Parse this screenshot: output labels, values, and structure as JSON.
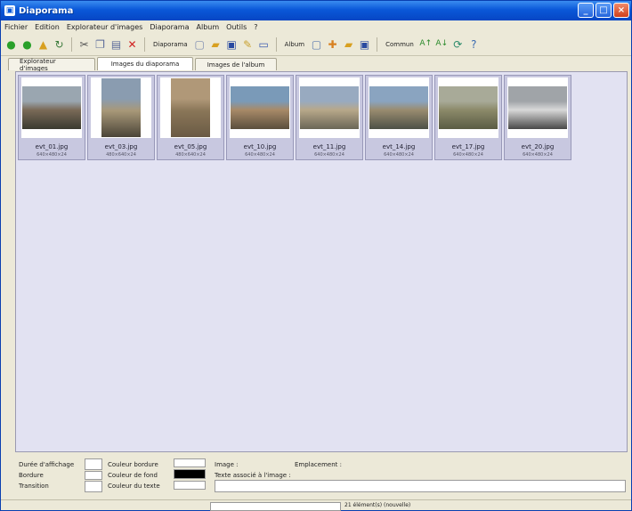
{
  "window": {
    "title": "Diaporama"
  },
  "menu": [
    "Fichier",
    "Edition",
    "Explorateur d'images",
    "Diaporama",
    "Album",
    "Outils",
    "?"
  ],
  "toolbar": {
    "diaporama_label": "Diaporama",
    "album_label": "Album",
    "commun_label": "Commun",
    "icons": [
      "back-icon",
      "forward-icon",
      "up-icon",
      "refresh-icon",
      "cut-icon",
      "copy-icon",
      "paste-icon",
      "delete-icon",
      "new-icon",
      "open-icon",
      "save-icon",
      "properties-icon",
      "view-icon",
      "album-new-icon",
      "album-add-icon",
      "album-open-icon",
      "album-save-icon",
      "sort-asc-icon",
      "sort-desc-icon",
      "rotate-icon",
      "help-icon"
    ]
  },
  "tabs": [
    {
      "label": "Explorateur d'images",
      "active": false
    },
    {
      "label": "Images du diaporama",
      "active": true
    },
    {
      "label": "Images de l'album",
      "active": false
    }
  ],
  "thumbnails": [
    {
      "name": "evt_01.jpg",
      "meta": "640×480×24",
      "colors": [
        "#9aa6b0",
        "#7a6a58",
        "#3a3a30"
      ]
    },
    {
      "name": "evt_03.jpg",
      "meta": "480×640×24",
      "colors": [
        "#8a9cb0",
        "#a89878",
        "#4a4438"
      ]
    },
    {
      "name": "evt_05.jpg",
      "meta": "480×640×24",
      "colors": [
        "#b09878",
        "#8a7658",
        "#6a5a44"
      ]
    },
    {
      "name": "evt_10.jpg",
      "meta": "640×480×24",
      "colors": [
        "#7a9ab8",
        "#a88a68",
        "#5a4e3c"
      ]
    },
    {
      "name": "evt_11.jpg",
      "meta": "640×480×24",
      "colors": [
        "#98aac0",
        "#b8a88a",
        "#6a6656"
      ]
    },
    {
      "name": "evt_14.jpg",
      "meta": "640×480×24",
      "colors": [
        "#8aa4c0",
        "#9a8c70",
        "#4c5046"
      ]
    },
    {
      "name": "evt_17.jpg",
      "meta": "640×480×24",
      "colors": [
        "#a8aa98",
        "#8c8a6a",
        "#5a5c44"
      ]
    },
    {
      "name": "evt_20.jpg",
      "meta": "640×480×24",
      "colors": [
        "#a0a4a8",
        "#d8d8d8",
        "#484848"
      ]
    }
  ],
  "properties": {
    "duree_label": "Durée d'affichage",
    "bordure_label": "Bordure",
    "transition_label": "Transition",
    "couleur_bordure_label": "Couleur bordure",
    "couleur_fond_label": "Couleur de fond",
    "couleur_texte_label": "Couleur du texte",
    "image_label": "Image :",
    "emplacement_label": "Emplacement :",
    "texte_label": "Texte associé à l'image :",
    "colors": {
      "bordure": "#ffffff",
      "fond": "#000000",
      "texte": "#ffffff"
    }
  },
  "status": {
    "text": "21 élément(s) (nouvelle)"
  }
}
